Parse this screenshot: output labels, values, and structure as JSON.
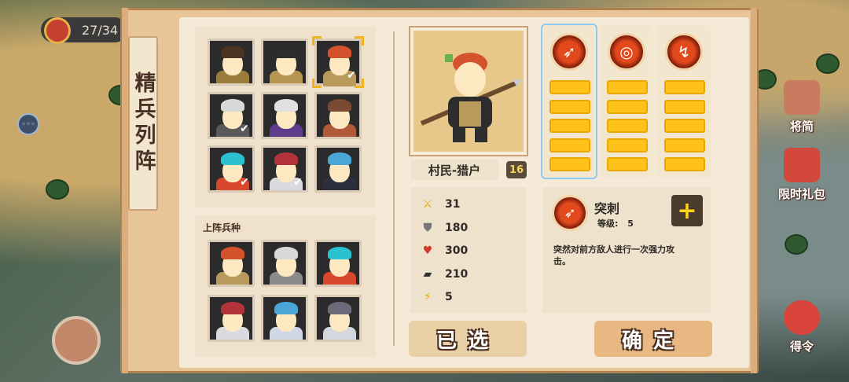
{
  "hud": {
    "counter": "27/34"
  },
  "menu_button": {
    "label": "◦◦◦"
  },
  "right_menu": [
    {
      "label": "将简",
      "color": "#c87b5e"
    },
    {
      "label": "限时礼包",
      "color": "#d2483a"
    },
    {
      "label": "得令",
      "color": "#d9453a"
    }
  ],
  "panel": {
    "side_title": "精兵列阵",
    "roster": [
      {
        "name": "hunter-brown",
        "hair": "#4b3424",
        "body": "#9a7d3a",
        "check": false
      },
      {
        "name": "hunter-dark",
        "hair": "#2c2c2c",
        "body": "#b69550",
        "check": false
      },
      {
        "name": "hunter-red",
        "hair": "#d5532c",
        "body": "#b79a5c",
        "check": true,
        "selected": true
      },
      {
        "name": "knight-silver",
        "hair": "#d8d8d8",
        "body": "#5a5a5a",
        "check": true
      },
      {
        "name": "mage-violet",
        "hair": "#e0e0e0",
        "body": "#5e3d8d",
        "check": false
      },
      {
        "name": "cart-wheel",
        "hair": "#7a4a32",
        "body": "#b05a3a",
        "check": false
      },
      {
        "name": "dragon-cyan",
        "hair": "#2ac2cf",
        "body": "#d7482d",
        "check": true
      },
      {
        "name": "armor-red",
        "hair": "#b3333b",
        "body": "#d9dbe0",
        "check": true
      },
      {
        "name": "armor-blue",
        "hair": "#49a6d7",
        "body": "#2d2f3e",
        "check": false
      }
    ],
    "deployed_label": "上阵兵种",
    "deployed": [
      {
        "name": "deployed-hunter-red",
        "hair": "#d5532c",
        "body": "#b79a5c"
      },
      {
        "name": "deployed-knight-silver",
        "hair": "#d8d8d8",
        "body": "#8a8a8a"
      },
      {
        "name": "deployed-dragon-cyan",
        "hair": "#2ac2cf",
        "body": "#d7482d"
      },
      {
        "name": "deployed-armor-red",
        "hair": "#b3333b",
        "body": "#d9dbe0"
      },
      {
        "name": "deployed-armor-blue",
        "hair": "#49a6d7",
        "body": "#cfd6e6"
      },
      {
        "name": "deployed-armor-dark",
        "hair": "#6b6b7a",
        "body": "#d5d7de"
      }
    ]
  },
  "unit": {
    "name": "村民-猎户",
    "level": "16",
    "stats": [
      {
        "icon": "sword-icon",
        "glyph": "⚔",
        "value": "31"
      },
      {
        "icon": "shield-icon",
        "glyph": "⛊",
        "value": "180"
      },
      {
        "icon": "heart-icon",
        "glyph": "♥",
        "value": "300"
      },
      {
        "icon": "boot-icon",
        "glyph": "▰",
        "value": "210"
      },
      {
        "icon": "lightning-icon",
        "glyph": "⚡",
        "value": "5"
      }
    ]
  },
  "skills": [
    {
      "icon": "spear-thrust-icon",
      "glyph": "➶",
      "bars": 5,
      "active": true
    },
    {
      "icon": "whirl-icon",
      "glyph": "◎",
      "bars": 5,
      "active": false
    },
    {
      "icon": "lightning-spear-icon",
      "glyph": "↯",
      "bars": 5,
      "active": false
    }
  ],
  "skill_detail": {
    "name": "突刺",
    "level_label": "等级:",
    "level_value": "5",
    "description": "突然对前方敌人进行一次强力攻击。"
  },
  "buttons": {
    "selected": "已选",
    "confirm": "确定"
  },
  "colors": {
    "accent": "#ffc21a",
    "panel": "#e8c596",
    "inner": "#f5ead8",
    "selection": "#f2b41c"
  }
}
